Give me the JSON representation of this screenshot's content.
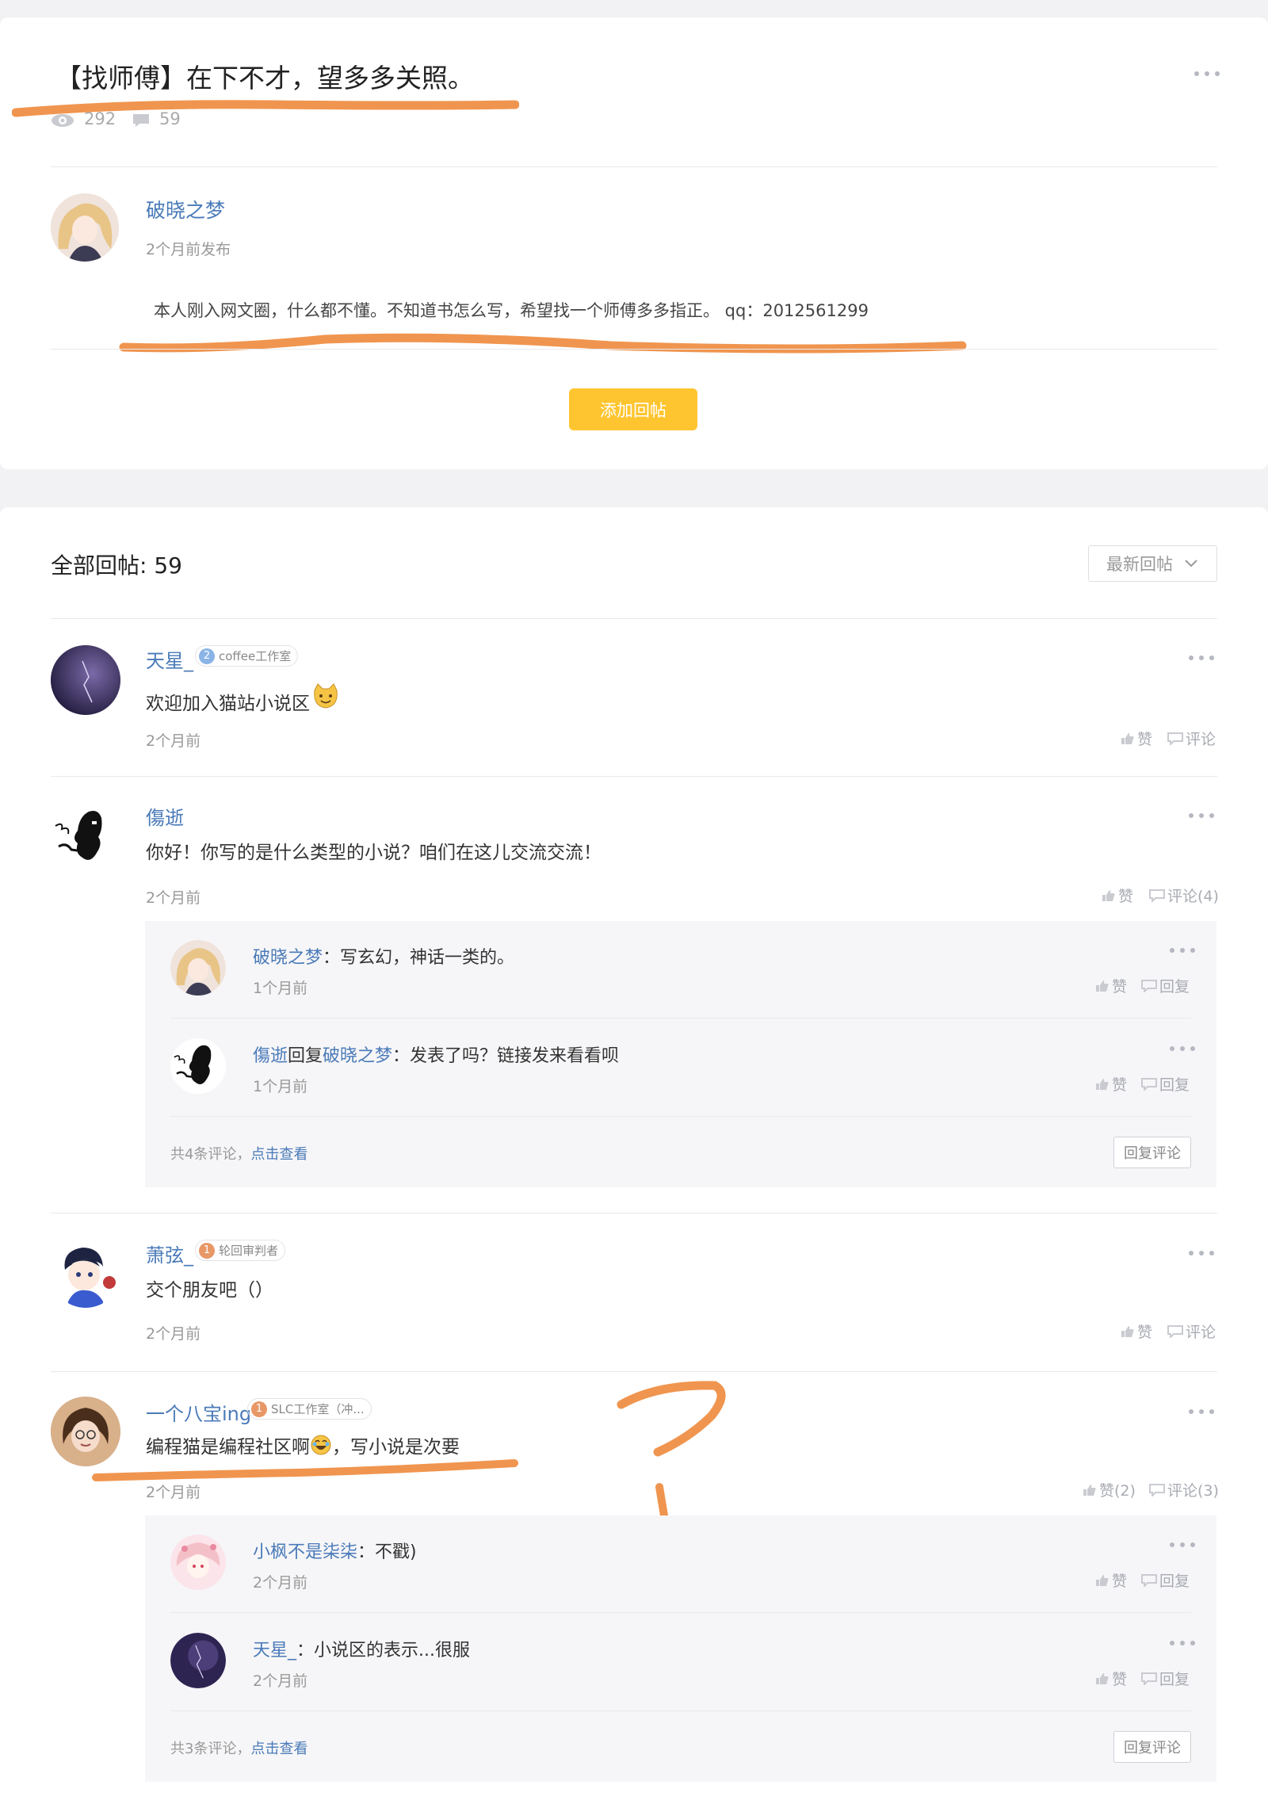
{
  "post": {
    "title": "【找师傅】在下不才，望多多关照。",
    "views": "292",
    "comments": "59",
    "author": "破晓之梦",
    "published": "2个月前发布",
    "content": "本人刚入网文圈，什么都不懂。不知道书怎么写，希望找一个师傅多多指正。 qq：2012561299",
    "add_reply_label": "添加回帖"
  },
  "replies_header": {
    "count_label": "全部回帖: 59",
    "sort_label": "最新回帖"
  },
  "actions": {
    "like": "赞",
    "comment": "评论",
    "reply": "回复",
    "reply_comment": "回复评论",
    "view_more": "点击查看",
    "reply_word": "回复"
  },
  "replies": [
    {
      "author": "天星_",
      "badge": {
        "level": "2",
        "text": "coffee工作室"
      },
      "content": "欢迎加入猫站小说区",
      "time": "2个月前",
      "like": "赞",
      "comment": "评论"
    },
    {
      "author": "傷逝",
      "content": "你好！你写的是什么类型的小说？咱们在这儿交流交流！",
      "time": "2个月前",
      "like": "赞",
      "comment": "评论(4)",
      "sub": [
        {
          "author": "破晓之梦",
          "content": "：写玄幻，神话一类的。",
          "time": "1个月前"
        },
        {
          "author": "傷逝",
          "reply_to": "破晓之梦",
          "content": "：发表了吗？链接发来看看呗",
          "time": "1个月前"
        }
      ],
      "sub_total": "共4条评论，"
    },
    {
      "author": "萧弦_",
      "badge": {
        "level": "1",
        "text": "轮回审判者"
      },
      "content": "交个朋友吧（）",
      "time": "2个月前",
      "like": "赞",
      "comment": "评论"
    },
    {
      "author": "一个八宝ing",
      "badge": {
        "level": "1",
        "text": "SLC工作室（冲..."
      },
      "content": "编程猫是编程社区啊",
      "content_tail": "，写小说是次要",
      "time": "2个月前",
      "like": "赞(2)",
      "comment": "评论(3)",
      "sub": [
        {
          "author": "小枫不是柒柒",
          "content": "：不戳)",
          "time": "2个月前"
        },
        {
          "author": "天星_",
          "content": "：小说区的表示...很服",
          "time": "2个月前"
        }
      ],
      "sub_total": "共3条评论，"
    }
  ],
  "annotation": {
    "mark": "?"
  },
  "colors": {
    "accent": "#ffc530",
    "link": "#4a7ab8",
    "marker": "#f0954f"
  }
}
